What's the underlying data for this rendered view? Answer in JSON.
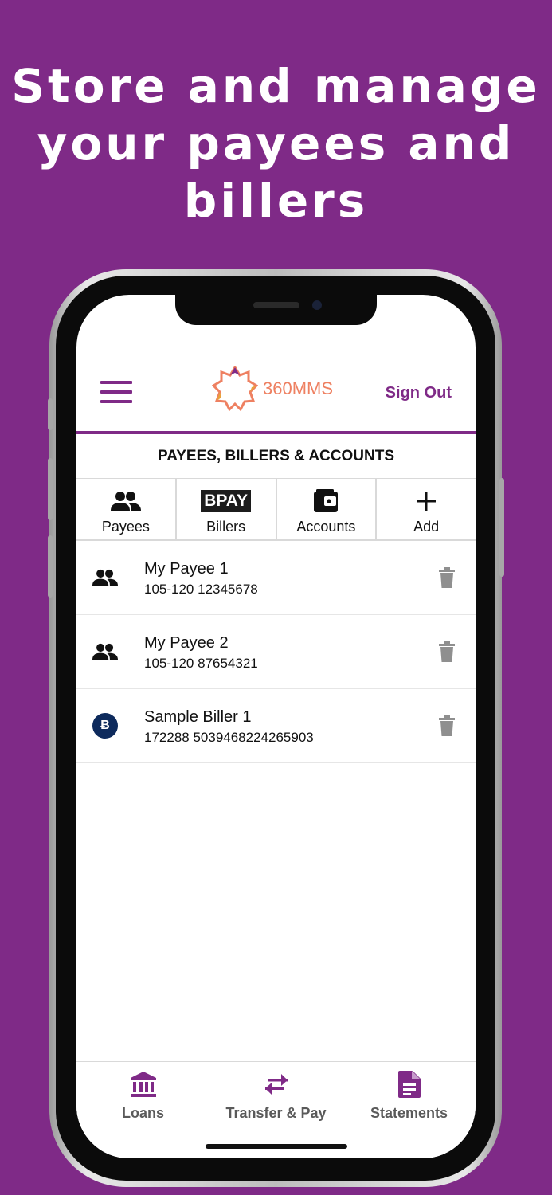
{
  "headline": {
    "line1": "Store and manage",
    "line2": "your payees and",
    "line3": "billers"
  },
  "header": {
    "brand": "360MMS",
    "sign_out": "Sign Out"
  },
  "section_title": "PAYEES, BILLERS & ACCOUNTS",
  "tabs": [
    {
      "label": "Payees",
      "icon": "people-icon"
    },
    {
      "label": "Billers",
      "icon": "bpay-logo",
      "logo_text": "BPAY"
    },
    {
      "label": "Accounts",
      "icon": "wallet-icon"
    },
    {
      "label": "Add",
      "icon": "plus-icon"
    }
  ],
  "items": [
    {
      "name": "My Payee 1",
      "detail": "105-120 12345678",
      "type": "payee",
      "icon": "people-icon"
    },
    {
      "name": "My Payee 2",
      "detail": "105-120 87654321",
      "type": "payee",
      "icon": "people-icon"
    },
    {
      "name": "Sample Biller 1",
      "detail": "172288 5039468224265903",
      "type": "biller",
      "icon": "bpay-badge-icon",
      "badge_text": "Ƀ"
    }
  ],
  "bottom_nav": [
    {
      "label": "Loans",
      "icon": "bank-icon"
    },
    {
      "label": "Transfer & Pay",
      "icon": "transfer-arrows-icon"
    },
    {
      "label": "Statements",
      "icon": "document-icon"
    }
  ],
  "colors": {
    "brand_purple": "#7f2a87",
    "logo_orange": "#ee8061",
    "biller_badge": "#0d2a5c"
  }
}
